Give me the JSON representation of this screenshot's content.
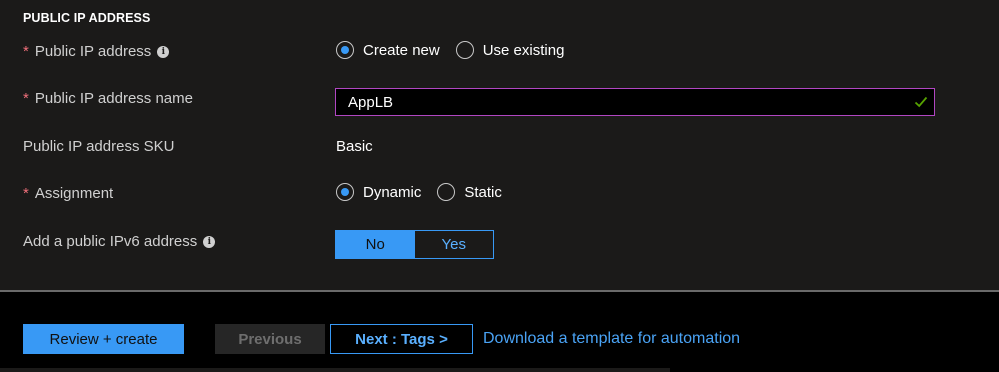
{
  "section": {
    "title": "PUBLIC IP ADDRESS"
  },
  "fields": {
    "public_ip": {
      "required_mark": "*",
      "label": "Public IP address",
      "info_icon": "info-icon",
      "options": [
        {
          "label": "Create new",
          "selected": true
        },
        {
          "label": "Use existing",
          "selected": false
        }
      ]
    },
    "public_ip_name": {
      "required_mark": "*",
      "label": "Public IP address name",
      "value": "AppLB",
      "validation_icon": "checkmark-icon"
    },
    "sku": {
      "label": "Public IP address SKU",
      "value": "Basic"
    },
    "assignment": {
      "required_mark": "*",
      "label": "Assignment",
      "options": [
        {
          "label": "Dynamic",
          "selected": true
        },
        {
          "label": "Static",
          "selected": false
        }
      ]
    },
    "ipv6": {
      "label": "Add a public IPv6 address",
      "info_icon": "info-icon",
      "options": [
        {
          "label": "No",
          "selected": true
        },
        {
          "label": "Yes",
          "selected": false
        }
      ]
    }
  },
  "footer": {
    "review_create_label": "Review + create",
    "previous_label": "Previous",
    "next_label": "Next : Tags >",
    "download_link": "Download a template for automation"
  },
  "colors": {
    "accent": "#3899f5",
    "required": "#f1707b",
    "valid": "#57a300",
    "input_focus_border": "#b146c2"
  }
}
